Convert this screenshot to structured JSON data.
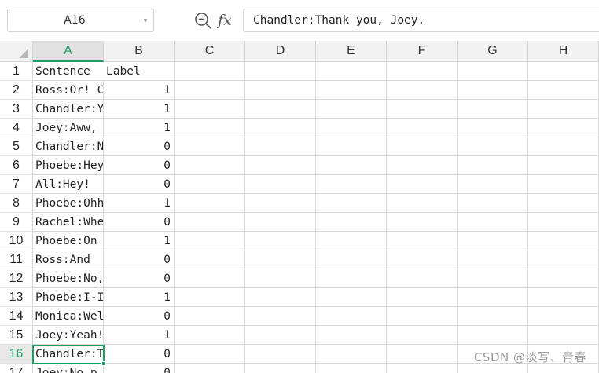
{
  "formula_bar": {
    "cell_reference": "A16",
    "dropdown_caret": "▾",
    "zoom_icon": "zoom-formula-icon",
    "fx_label": "fx",
    "formula_value": "Chandler:Thank you, Joey."
  },
  "sheet": {
    "columns": [
      "A",
      "B",
      "C",
      "D",
      "E",
      "F",
      "G",
      "H"
    ],
    "active_column": "A",
    "active_row": "16",
    "rows": [
      {
        "num": "1",
        "a": "Sentence",
        "b": "Label"
      },
      {
        "num": "2",
        "a": "Ross:Or! C",
        "b": "1"
      },
      {
        "num": "3",
        "a": "Chandler:Y",
        "b": "1"
      },
      {
        "num": "4",
        "a": "Joey:Aww,",
        "b": "1"
      },
      {
        "num": "5",
        "a": "Chandler:N",
        "b": "0"
      },
      {
        "num": "6",
        "a": "Phoebe:Hey",
        "b": "0"
      },
      {
        "num": "7",
        "a": "All:Hey!",
        "b": "0"
      },
      {
        "num": "8",
        "a": "Phoebe:Ohh",
        "b": "1"
      },
      {
        "num": "9",
        "a": "Rachel:Whe",
        "b": "0"
      },
      {
        "num": "10",
        "a": "Phoebe:On",
        "b": "1"
      },
      {
        "num": "11",
        "a": "Ross:And",
        "b": "0"
      },
      {
        "num": "12",
        "a": "Phoebe:No,",
        "b": "0"
      },
      {
        "num": "13",
        "a": "Phoebe:I-I",
        "b": "1"
      },
      {
        "num": "14",
        "a": "Monica:Wel",
        "b": "0"
      },
      {
        "num": "15",
        "a": "Joey:Yeah!",
        "b": "1"
      },
      {
        "num": "16",
        "a": "Chandler:T",
        "b": "0"
      },
      {
        "num": "17",
        "a": "Joey:No p",
        "b": "0"
      }
    ]
  },
  "watermark": "CSDN @淡写、青春",
  "colors": {
    "accent": "#1e9e62",
    "header_bg": "#f2f2f2",
    "gridline": "#d9d9d9"
  }
}
